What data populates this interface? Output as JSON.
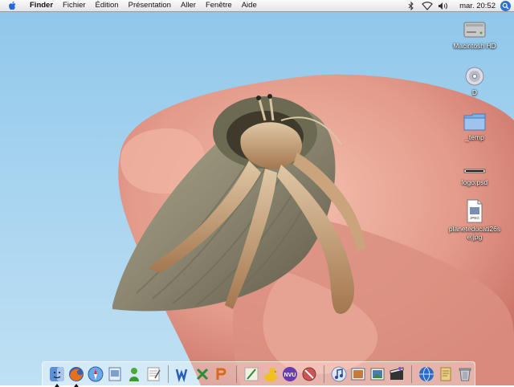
{
  "menubar": {
    "apple_icon": "apple-logo-icon",
    "items": [
      {
        "label": "Finder",
        "bold": true
      },
      {
        "label": "Fichier"
      },
      {
        "label": "Édition"
      },
      {
        "label": "Présentation"
      },
      {
        "label": "Aller"
      },
      {
        "label": "Fenêtre"
      },
      {
        "label": "Aide"
      }
    ],
    "status_icons": [
      "bluetooth-icon",
      "wifi-icon",
      "volume-icon"
    ],
    "clock": "mar. 20:52",
    "spotlight_icon": "spotlight-search-icon"
  },
  "desktop_icons": [
    {
      "name": "Macintosh HD",
      "icon": "hard-drive-icon"
    },
    {
      "name": "D",
      "icon": "disc-icon"
    },
    {
      "name": "_temp",
      "icon": "folder-icon"
    },
    {
      "name": "logo.psd",
      "icon": "psd-file-icon"
    },
    {
      "name": "planeteducati26se.jpg",
      "icon": "jpeg-file-icon"
    }
  ],
  "dock": {
    "items": [
      {
        "icon": "finder-icon",
        "running": true
      },
      {
        "icon": "firefox-icon",
        "running": true
      },
      {
        "icon": "safari-icon"
      },
      {
        "icon": "preview-icon"
      },
      {
        "icon": "adium-icon"
      },
      {
        "icon": "textedit-icon"
      },
      {
        "icon": "word-icon"
      },
      {
        "icon": "excel-icon"
      },
      {
        "icon": "powerpoint-icon"
      },
      {
        "icon": "pen-app-icon"
      },
      {
        "icon": "cyberduck-icon"
      },
      {
        "icon": "nvu-icon"
      },
      {
        "icon": "no-entry-icon"
      },
      {
        "icon": "itunes-icon"
      },
      {
        "icon": "photo-app-icon"
      },
      {
        "icon": "iphoto-icon"
      },
      {
        "icon": "imovie-icon"
      },
      {
        "icon": "network-globe-icon"
      },
      {
        "icon": "notepad-icon"
      },
      {
        "icon": "trash-icon"
      }
    ],
    "separator_after": [
      5,
      8,
      12,
      16
    ]
  },
  "wallpaper": {
    "subject": "hermit-crab-on-fingers",
    "sky_color": "#a6d3ef",
    "skin_color": "#e8a79a",
    "shell_color": "#8b8a72"
  }
}
